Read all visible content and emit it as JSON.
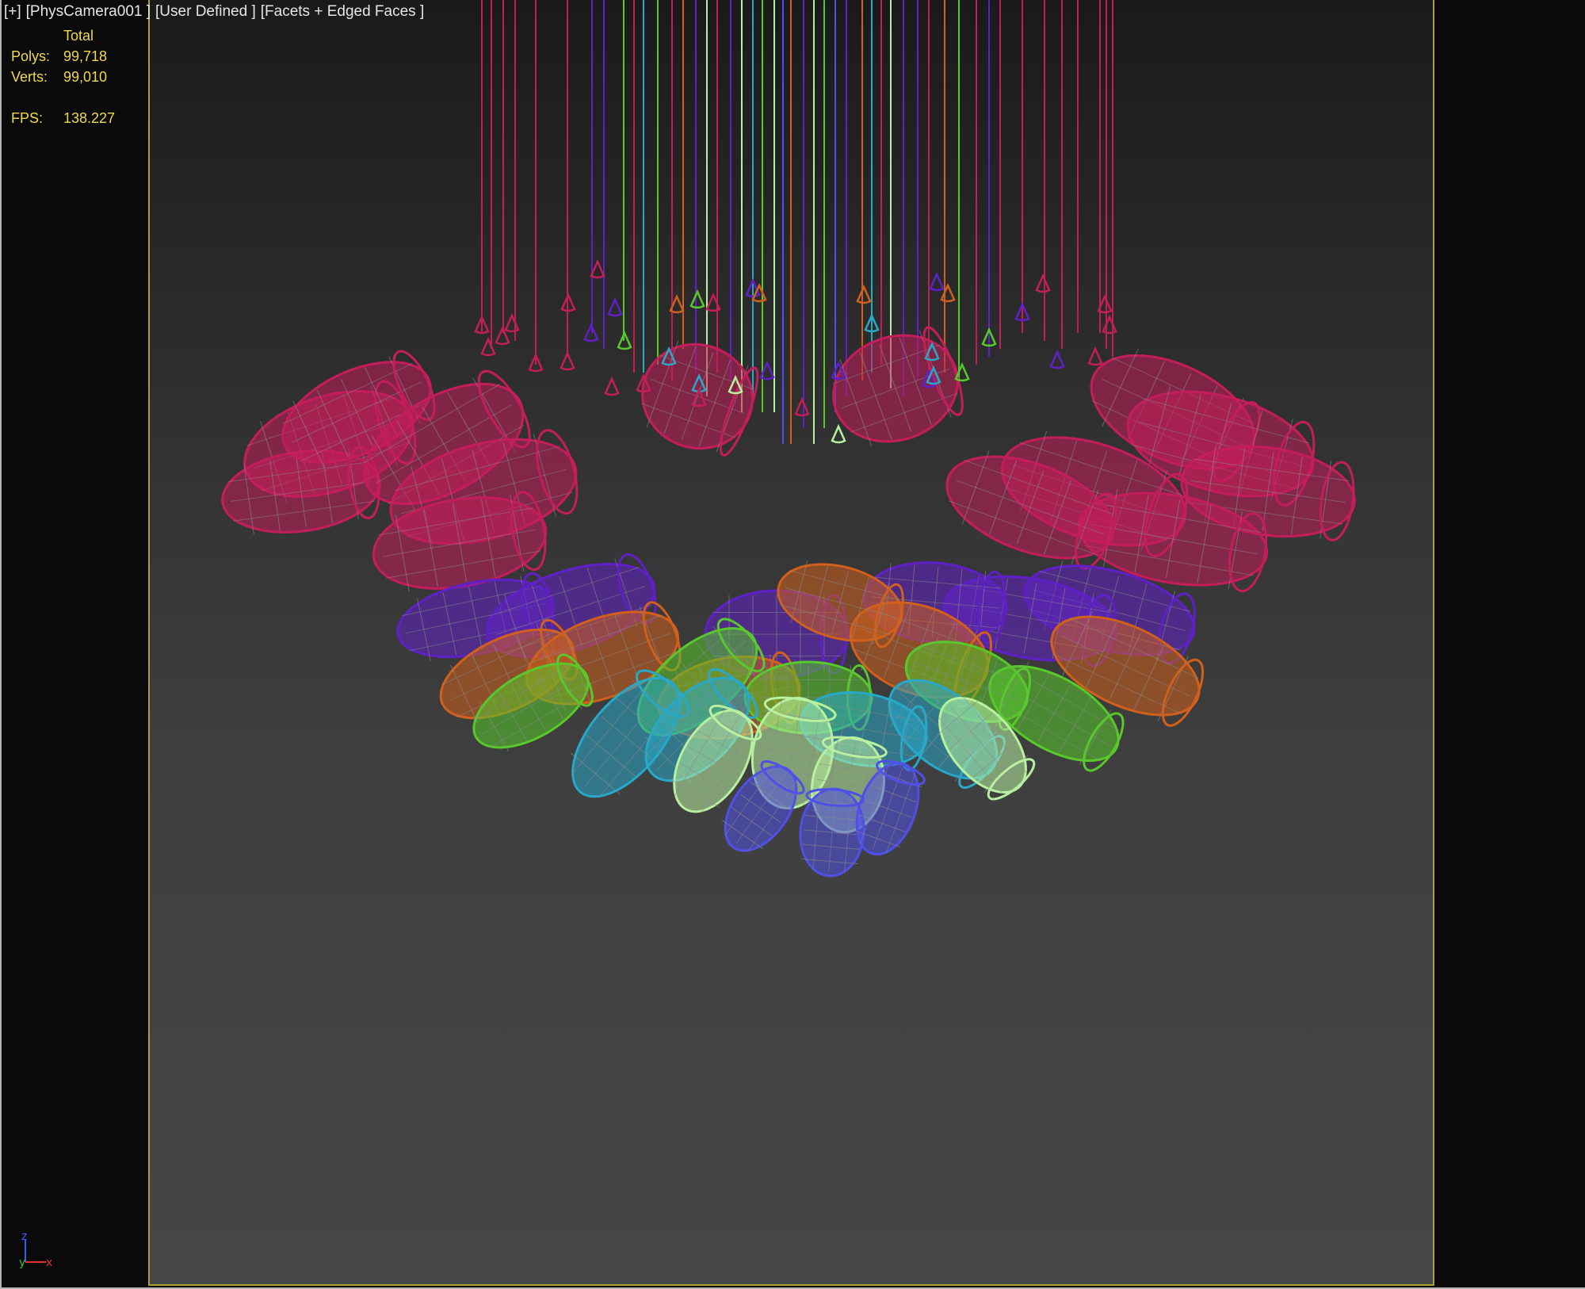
{
  "viewport": {
    "label_menu": "[+]",
    "label_camera": "[PhysCamera001 ]",
    "label_view": "[User Defined ]",
    "label_shading": "[Facets + Edged Faces ]"
  },
  "stats": {
    "header": "Total",
    "polys_label": "Polys:",
    "polys_value": "99,718",
    "verts_label": "Verts:",
    "verts_value": "99,010",
    "fps_label": "FPS:",
    "fps_value": "138.227"
  },
  "axis_gizmo": {
    "z_label": "z",
    "y_label": "y",
    "x_label": "x",
    "colors": {
      "z": "#3c5cff",
      "y": "#30c030",
      "x": "#e03030"
    }
  },
  "colors": {
    "magenta": "#c41e5a",
    "purple": "#6020c8",
    "orange": "#d0601c",
    "green": "#58c82c",
    "cyan": "#28a8c8",
    "pale_green": "#b8f0a0",
    "blue": "#5050e8",
    "frame": "#a8a030",
    "stats_text": "#f0d850"
  }
}
